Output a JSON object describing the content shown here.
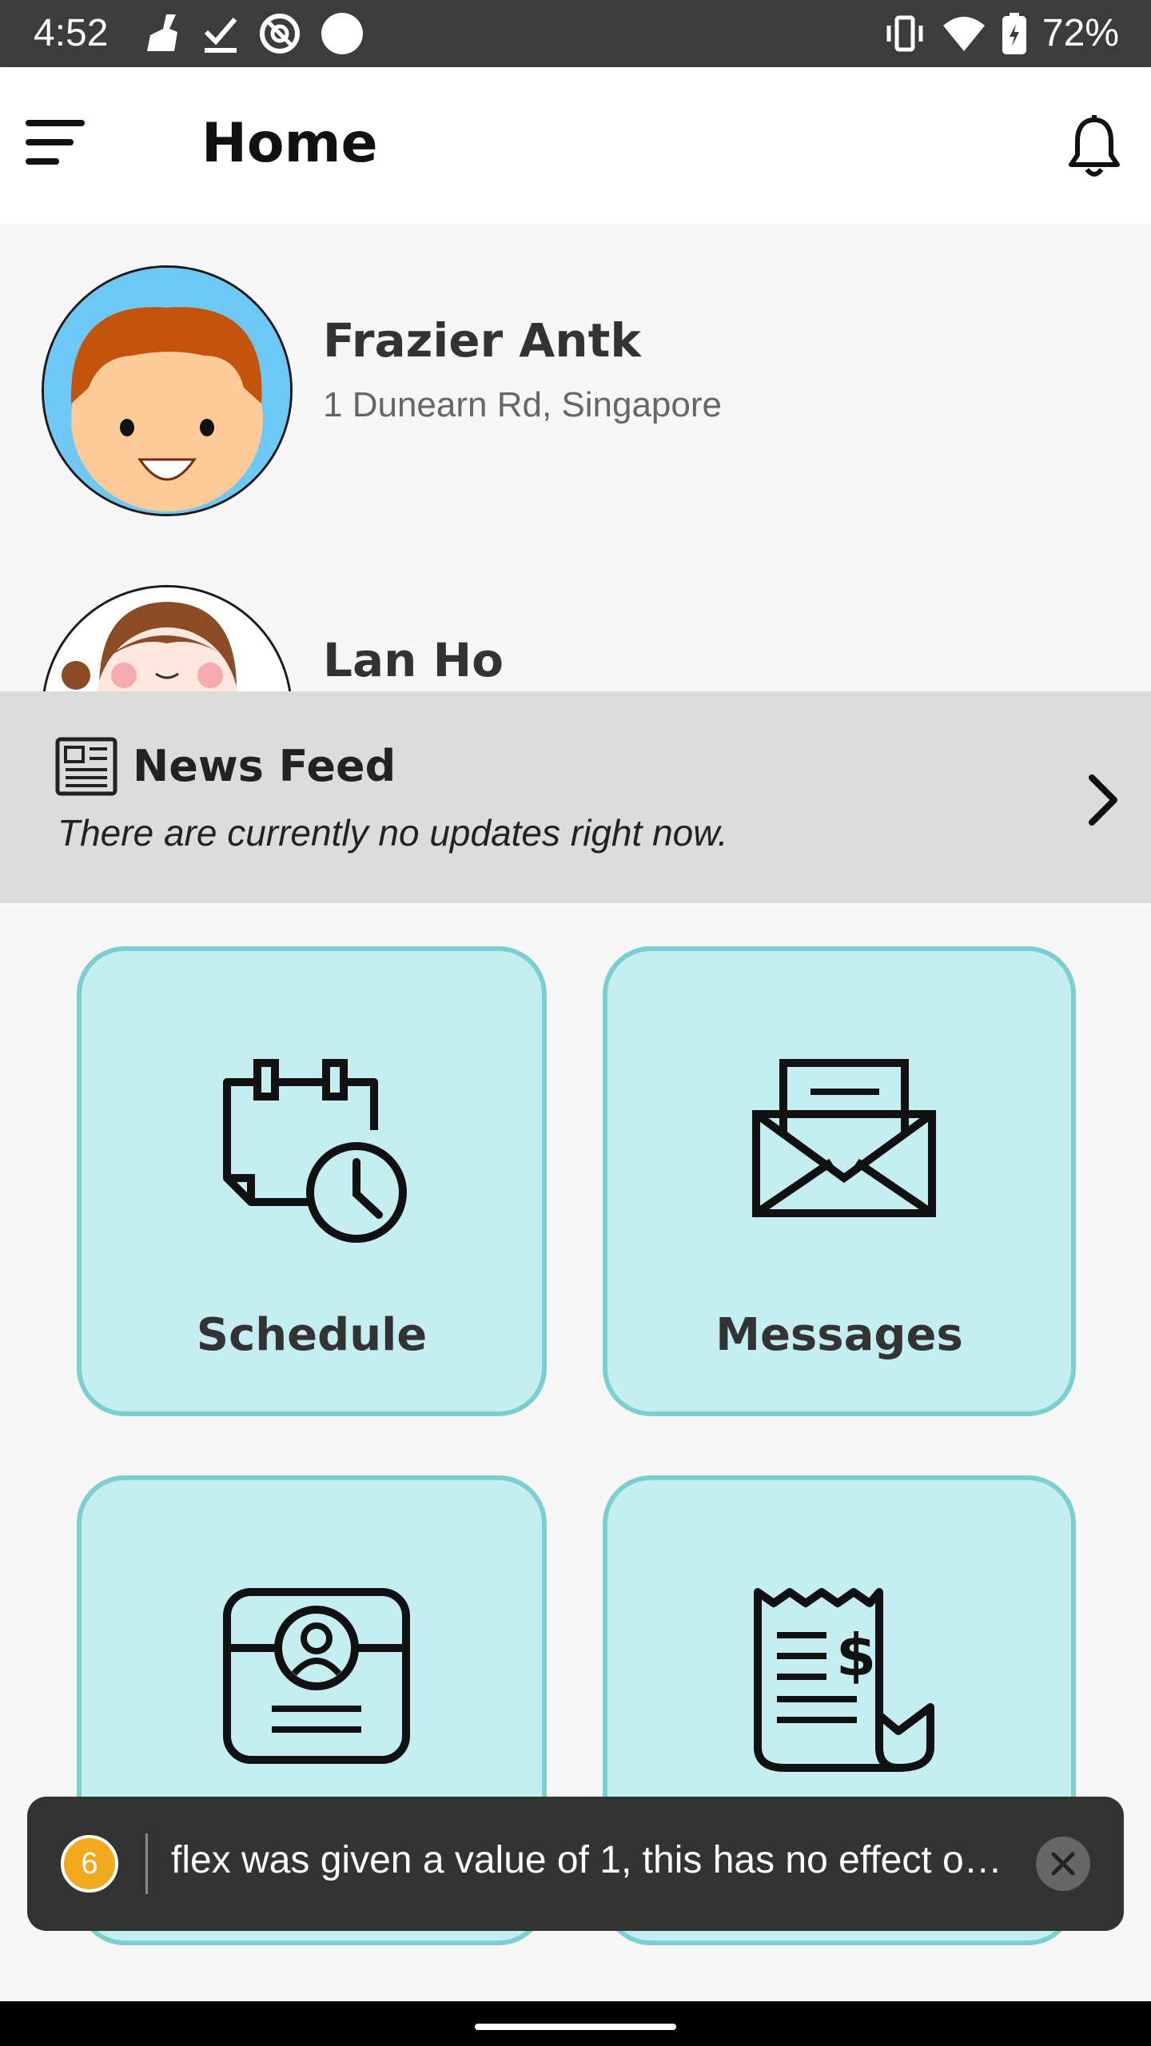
{
  "status_bar": {
    "time": "4:52",
    "battery": "72%"
  },
  "header": {
    "title": "Home"
  },
  "profiles": [
    {
      "name": "Frazier Antk",
      "address": "1 Dunearn Rd, Singapore"
    },
    {
      "name": "Lan Ho"
    }
  ],
  "news_feed": {
    "title": "News Feed",
    "message": "There are currently no updates right now."
  },
  "tiles": [
    {
      "label": "Schedule",
      "icon": "calendar-clock-icon"
    },
    {
      "label": "Messages",
      "icon": "open-envelope-icon"
    },
    {
      "label": "",
      "icon": "id-card-icon"
    },
    {
      "label": "",
      "icon": "receipt-dollar-icon"
    }
  ],
  "toast": {
    "count": "6",
    "message": "flex was given a value of 1, this has no effect o…"
  },
  "colors": {
    "tile_bg": "#c5eef0",
    "tile_border": "#7ccfd1",
    "news_bg": "#dcdcdc",
    "toast_badge": "#f2a91c"
  }
}
